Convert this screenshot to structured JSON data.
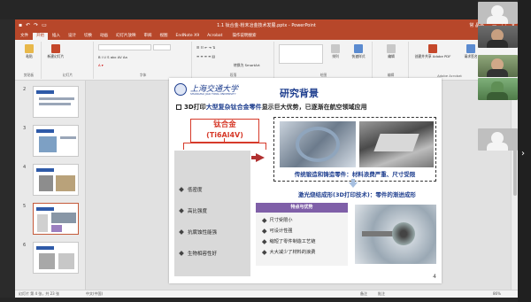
{
  "window": {
    "title": "1.1 钛合金-粉末冶金技术发展.pptx - PowerPoint",
    "user": "常 晶晶",
    "controls": [
      "—",
      "□",
      "✕"
    ]
  },
  "tabs": [
    "文件",
    "开始",
    "插入",
    "设计",
    "切换",
    "动画",
    "幻灯片放映",
    "审阅",
    "视图",
    "EndNote X9",
    "Acrobat"
  ],
  "active_tab": "开始",
  "search_placeholder": "操作说明搜索",
  "share_label": "共享",
  "ribbon": {
    "groups": [
      "剪贴板",
      "幻灯片",
      "字体",
      "段落",
      "绘图",
      "编辑",
      "Adobe Acrobat"
    ],
    "paste": "粘贴",
    "new_slide": "新建幻灯片",
    "arrange": "排列",
    "quick_styles": "快速样式",
    "editing": "编辑",
    "create_pdf": "创建并共享 Adobe PDF",
    "request_sign": "请求签名",
    "convert_smartart": "转换为 SmartArt"
  },
  "thumbnails": [
    {
      "num": "2"
    },
    {
      "num": "3"
    },
    {
      "num": "4"
    },
    {
      "num": "5"
    },
    {
      "num": "6"
    }
  ],
  "slide": {
    "university_cn": "上海交通大学",
    "university_en": "SHANGHAI JIAO TONG UNIVERSITY",
    "title": "研究背景",
    "headline_num": "3D打印",
    "headline_hl": "大型复杂钛合金零件",
    "headline_rest": "显示巨大优势，已逐渐在航空领域应用",
    "alloy_line1": "钛合金",
    "alloy_line2": "(Ti6Al4V)",
    "properties": [
      "低密度",
      "高比强度",
      "抗腐蚀性能强",
      "生物相容性好"
    ],
    "caption1": "传统锻造和铸造零件：材料浪费严重、尺寸受限",
    "caption2": "激光烧结成形(3D打印技术)：零件的渐进成形",
    "advantages_header": "特点与优势",
    "advantages": [
      "尺寸受限小",
      "可设计性强",
      "缩短了零件制造工艺链",
      "大大减少了材料的浪费"
    ],
    "page_number": "4"
  },
  "status": {
    "slide_info": "幻灯片 第 4 张，共 23 张",
    "language": "中文(中国)",
    "notes": "备注",
    "comments": "批注",
    "zoom": "86%"
  },
  "colors": {
    "ppt_accent": "#b7472a",
    "sjtu_blue": "#1f3f8f",
    "alloy_red": "#d63a2a",
    "adv_header": "#7f5fa8"
  }
}
